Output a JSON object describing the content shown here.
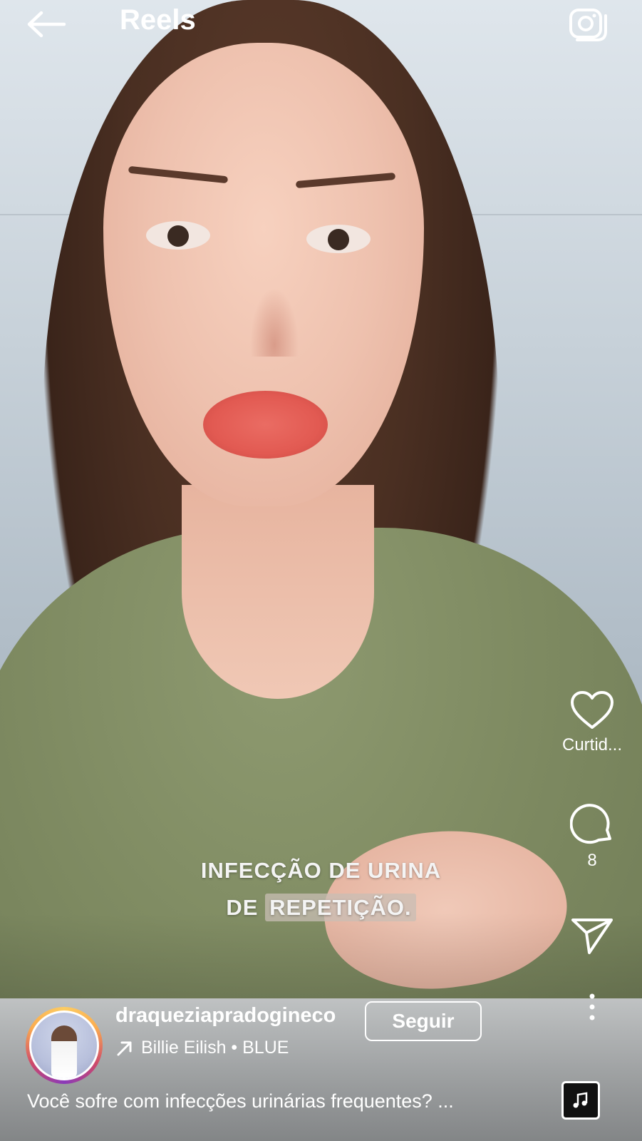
{
  "header": {
    "title": "Reels"
  },
  "video": {
    "caption_line1": "INFECÇÃO DE URINA",
    "caption_line2_prefix": "DE ",
    "caption_line2_highlight": "REPETIÇÃO."
  },
  "actions": {
    "like_label": "Curtid...",
    "comment_count": "8"
  },
  "post": {
    "username": "draqueziapradogineco",
    "audio": "Billie Eilish • BLUE",
    "follow_label": "Seguir",
    "description": "Você sofre com infecções urinárias frequentes? ..."
  },
  "icons": {
    "back": "arrow-left-icon",
    "camera": "camera-icon",
    "like": "heart-icon",
    "comment": "comment-icon",
    "share": "send-icon",
    "more": "more-vertical-icon",
    "audio": "trending-arrow-icon",
    "album": "music-note-icon"
  }
}
